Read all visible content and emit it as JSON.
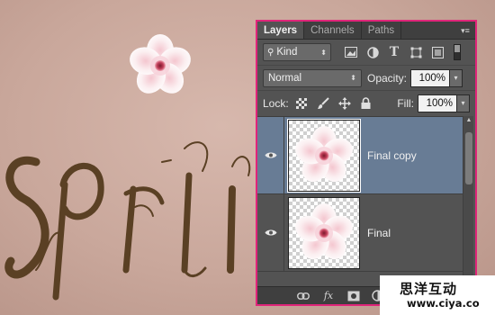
{
  "panel": {
    "tabs": [
      {
        "label": "Layers",
        "active": true
      },
      {
        "label": "Channels",
        "active": false
      },
      {
        "label": "Paths",
        "active": false
      }
    ],
    "menu_icon": "panel-menu-icon",
    "filter": {
      "kind_label": "Kind",
      "icons": [
        "pixel-filter-icon",
        "adjustment-filter-icon",
        "type-filter-icon",
        "shape-filter-icon",
        "smart-object-filter-icon"
      ]
    },
    "blend_mode": "Normal",
    "opacity_label": "Opacity:",
    "opacity_value": "100%",
    "lock_label": "Lock:",
    "lock_icons": [
      "lock-transparent-icon",
      "lock-paint-icon",
      "lock-position-icon",
      "lock-all-icon"
    ],
    "fill_label": "Fill:",
    "fill_value": "100%",
    "layers": [
      {
        "name": "Final copy",
        "visible": true,
        "selected": true
      },
      {
        "name": "Final",
        "visible": true,
        "selected": false
      }
    ],
    "bottom_icons": [
      "link-layers-icon",
      "fx-icon",
      "add-mask-icon",
      "adjustment-layer-icon",
      "group-folder-icon"
    ],
    "fx_label": "fx"
  },
  "canvas": {
    "text": "Sprin"
  },
  "watermark": {
    "chinese": "思洋互动",
    "url": "www.ciya.co"
  },
  "colors": {
    "background": "#cfae a2",
    "panel_bg": "#535353",
    "selected_layer": "#687c95",
    "highlight_border": "#e0257a",
    "script_text": "#5a4024"
  }
}
